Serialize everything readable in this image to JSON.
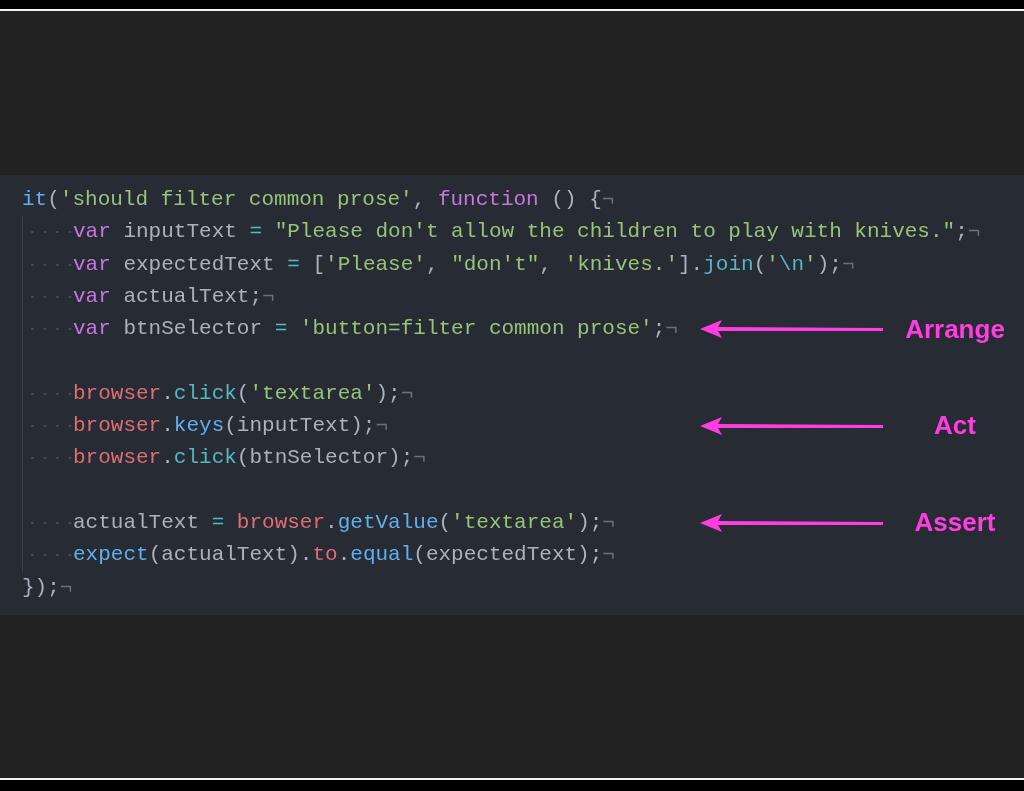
{
  "editor": {
    "lines": [
      {
        "kind": "code",
        "eol": "¬",
        "tokens": [
          {
            "kind": "fn",
            "text": "it"
          },
          {
            "kind": "plain",
            "text": "("
          },
          {
            "kind": "str",
            "text": "'should filter common prose'"
          },
          {
            "kind": "plain",
            "text": ", "
          },
          {
            "kind": "kw",
            "text": "function"
          },
          {
            "kind": "plain",
            "text": " () {"
          }
        ],
        "children": [
          {
            "kind": "code",
            "eol": "¬",
            "tokens": [
              {
                "kind": "kw",
                "text": "var"
              },
              {
                "kind": "plain",
                "text": " inputText "
              },
              {
                "kind": "op",
                "text": "= "
              },
              {
                "kind": "str",
                "text": "\"Please don't allow the children to play with knives.\""
              },
              {
                "kind": "plain",
                "text": ";"
              }
            ]
          },
          {
            "kind": "code",
            "eol": "¬",
            "tokens": [
              {
                "kind": "kw",
                "text": "var"
              },
              {
                "kind": "plain",
                "text": " expectedText "
              },
              {
                "kind": "op",
                "text": "="
              },
              {
                "kind": "plain",
                "text": " ["
              },
              {
                "kind": "str",
                "text": "'Please'"
              },
              {
                "kind": "plain",
                "text": ", "
              },
              {
                "kind": "str",
                "text": "\"don't\""
              },
              {
                "kind": "plain",
                "text": ", "
              },
              {
                "kind": "str",
                "text": "'knives.'"
              },
              {
                "kind": "plain",
                "text": "]."
              },
              {
                "kind": "method",
                "text": "join"
              },
              {
                "kind": "plain",
                "text": "("
              },
              {
                "kind": "str",
                "text": "'"
              },
              {
                "kind": "method",
                "text": "\\n"
              },
              {
                "kind": "str",
                "text": "'"
              },
              {
                "kind": "plain",
                "text": ");"
              }
            ]
          },
          {
            "kind": "code",
            "eol": "¬",
            "tokens": [
              {
                "kind": "kw",
                "text": "var"
              },
              {
                "kind": "plain",
                "text": " actualText;"
              }
            ]
          },
          {
            "kind": "code",
            "eol": "¬",
            "annotation": "Arrange",
            "tokens": [
              {
                "kind": "kw",
                "text": "var"
              },
              {
                "kind": "plain",
                "text": " btnSelector "
              },
              {
                "kind": "op",
                "text": "= "
              },
              {
                "kind": "str",
                "text": "'button=filter common prose'"
              },
              {
                "kind": "plain",
                "text": ";"
              }
            ]
          },
          {
            "kind": "blank"
          },
          {
            "kind": "code",
            "eol": "¬",
            "tokens": [
              {
                "kind": "obj",
                "text": "browser"
              },
              {
                "kind": "plain",
                "text": "."
              },
              {
                "kind": "method",
                "text": "click"
              },
              {
                "kind": "plain",
                "text": "("
              },
              {
                "kind": "str",
                "text": "'textarea'"
              },
              {
                "kind": "plain",
                "text": ");"
              }
            ]
          },
          {
            "kind": "code",
            "eol": "¬",
            "annotation": "Act",
            "tokens": [
              {
                "kind": "obj",
                "text": "browser"
              },
              {
                "kind": "plain",
                "text": "."
              },
              {
                "kind": "fn",
                "text": "keys"
              },
              {
                "kind": "plain",
                "text": "(inputText);"
              }
            ]
          },
          {
            "kind": "code",
            "eol": "¬",
            "tokens": [
              {
                "kind": "obj",
                "text": "browser"
              },
              {
                "kind": "plain",
                "text": "."
              },
              {
                "kind": "method",
                "text": "click"
              },
              {
                "kind": "plain",
                "text": "(btnSelector);"
              }
            ]
          },
          {
            "kind": "blank"
          },
          {
            "kind": "code",
            "eol": "¬",
            "annotation": "Assert",
            "tokens": [
              {
                "kind": "plain",
                "text": "actualText "
              },
              {
                "kind": "op",
                "text": "= "
              },
              {
                "kind": "obj",
                "text": "browser"
              },
              {
                "kind": "plain",
                "text": "."
              },
              {
                "kind": "fn",
                "text": "getValue"
              },
              {
                "kind": "plain",
                "text": "("
              },
              {
                "kind": "str",
                "text": "'textarea'"
              },
              {
                "kind": "plain",
                "text": ");"
              }
            ]
          },
          {
            "kind": "code",
            "eol": "¬",
            "tokens": [
              {
                "kind": "fn",
                "text": "expect"
              },
              {
                "kind": "plain",
                "text": "(actualText)."
              },
              {
                "kind": "obj",
                "text": "to"
              },
              {
                "kind": "plain",
                "text": "."
              },
              {
                "kind": "fn",
                "text": "equal"
              },
              {
                "kind": "plain",
                "text": "(expectedText);"
              }
            ]
          }
        ]
      },
      {
        "kind": "code",
        "eol": "¬",
        "tokens": [
          {
            "kind": "plain",
            "text": "});"
          }
        ]
      }
    ]
  }
}
